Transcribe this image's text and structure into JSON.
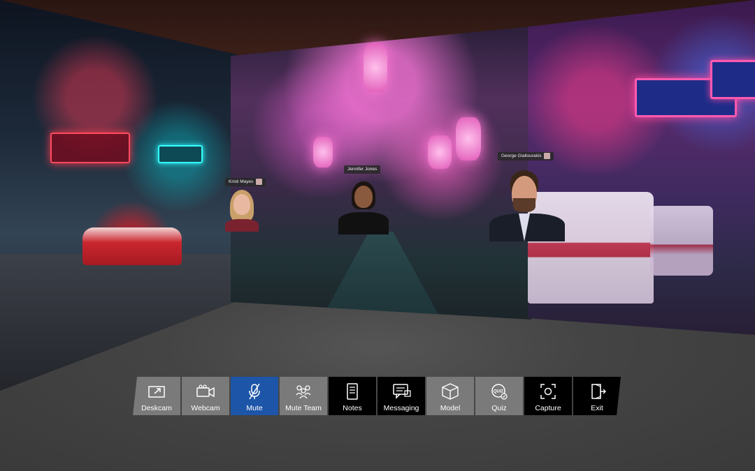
{
  "participants": [
    {
      "name": "Kristi Mayes"
    },
    {
      "name": "Jennifer Jones"
    },
    {
      "name": "George Giallourakis"
    }
  ],
  "toolbar": {
    "buttons": [
      {
        "label": "Deskcam",
        "icon": "deskcam-icon"
      },
      {
        "label": "Webcam",
        "icon": "webcam-icon"
      },
      {
        "label": "Mute",
        "icon": "mic-muted-icon",
        "active": true
      },
      {
        "label": "Mute Team",
        "icon": "team-muted-icon"
      },
      {
        "label": "Notes",
        "icon": "notes-icon"
      },
      {
        "label": "Messaging",
        "icon": "messaging-icon"
      },
      {
        "label": "Model",
        "icon": "cube-icon"
      },
      {
        "label": "Quiz",
        "icon": "quiz-icon"
      },
      {
        "label": "Capture",
        "icon": "capture-icon"
      },
      {
        "label": "Exit",
        "icon": "exit-icon"
      }
    ]
  },
  "colors": {
    "toolbar_dark": "#000000",
    "toolbar_light": "#7a7a7a",
    "toolbar_active": "#1d55a8"
  }
}
